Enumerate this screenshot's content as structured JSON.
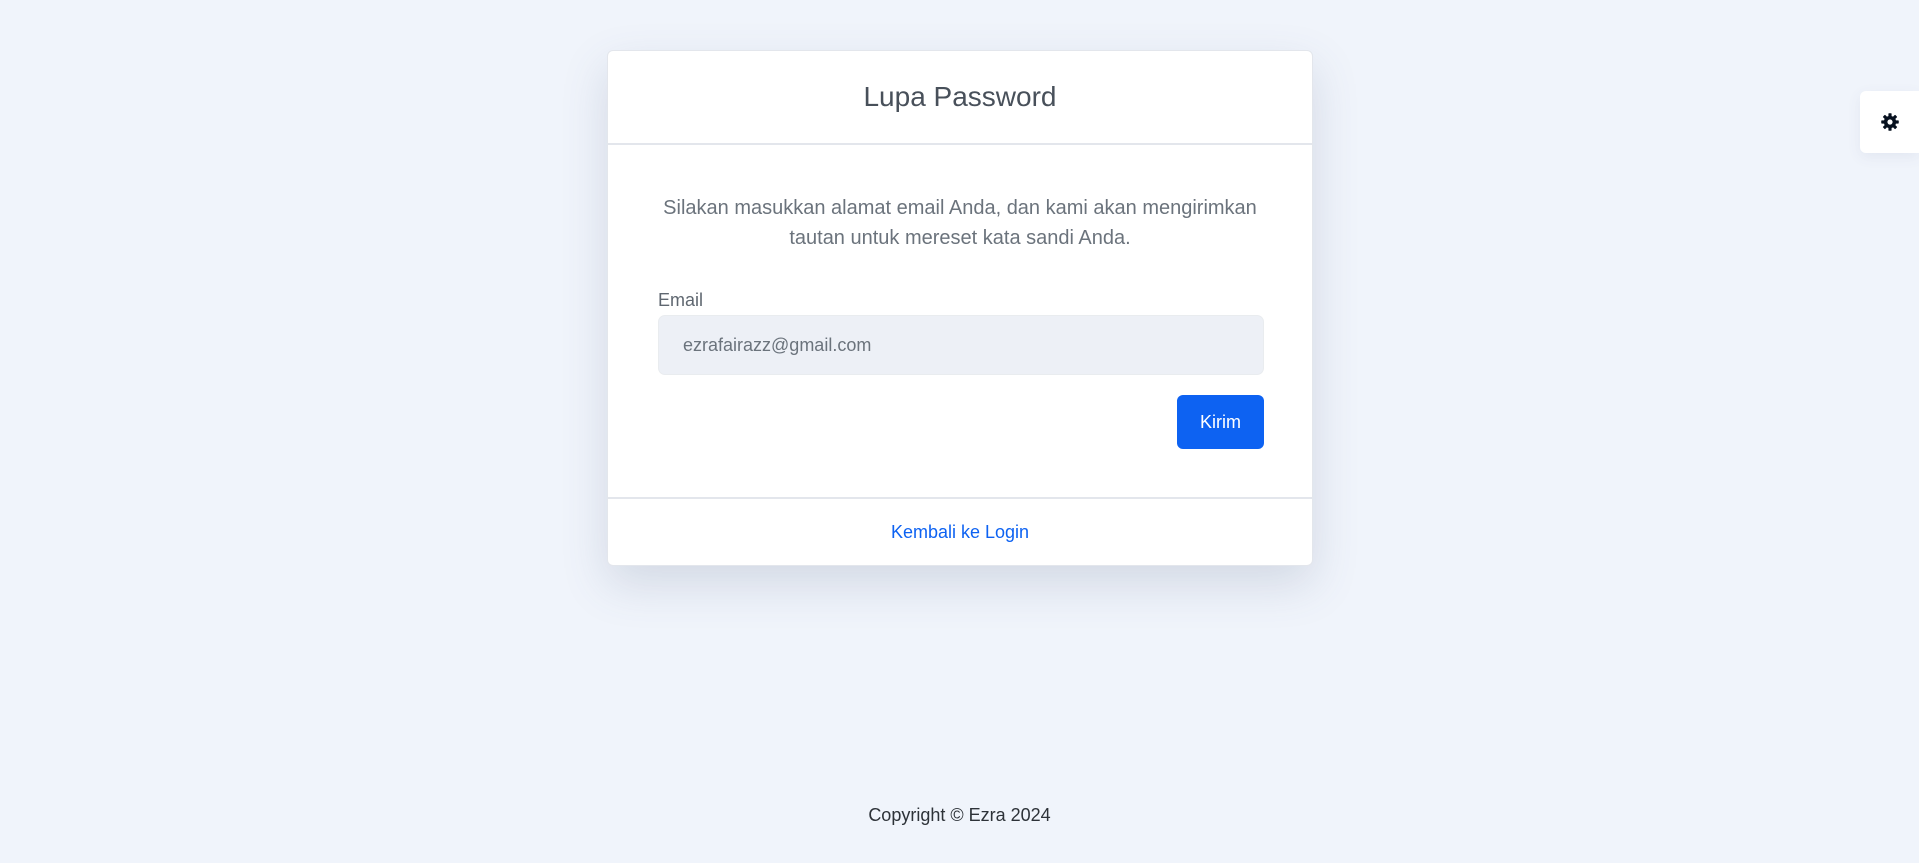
{
  "card": {
    "title": "Lupa Password",
    "intro_line_1": "Silakan masukkan alamat email Anda, dan kami akan mengirimkan",
    "intro_line_2": "tautan untuk mereset kata sandi Anda.",
    "email_label": "Email",
    "email_value": "ezrafairazz@gmail.com",
    "submit_label": "Kirim",
    "back_link_label": "Kembali ke Login"
  },
  "settings": {
    "icon": "gear-icon"
  },
  "footer": {
    "copyright": "Copyright © Ezra 2024"
  },
  "colors": {
    "page_background": "#f0f4fb",
    "primary": "#0d62f2",
    "input_background": "#edf0f6",
    "muted_text": "#6b737c"
  }
}
